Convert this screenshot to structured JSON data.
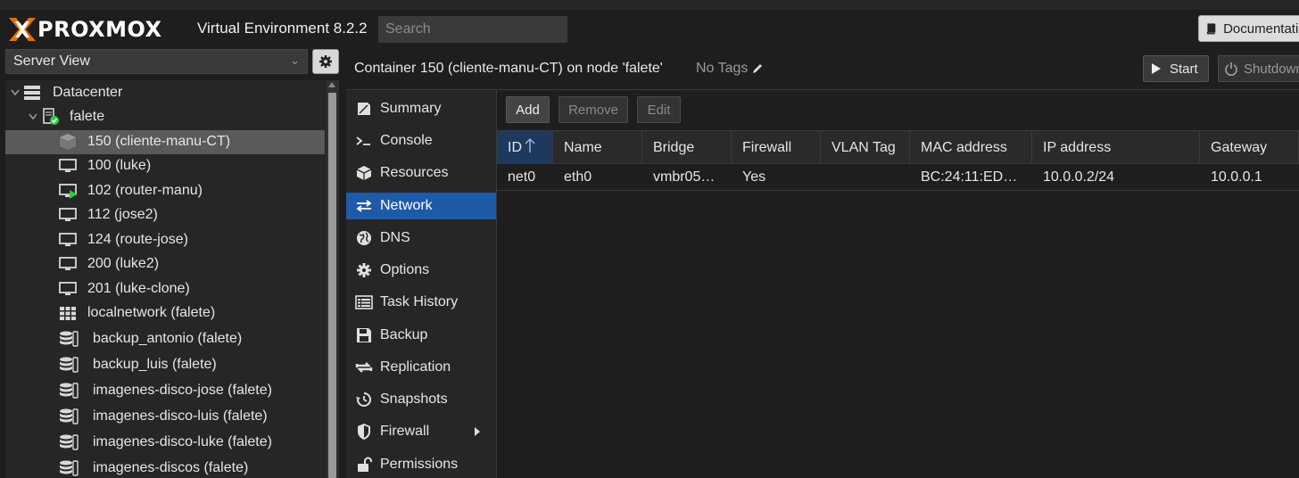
{
  "app": {
    "brand": "PROXMOX",
    "version": "Virtual Environment 8.2.2",
    "search_placeholder": "Search",
    "documentation": "Documentation"
  },
  "view_selector": {
    "value": "Server View"
  },
  "tree": [
    {
      "label": "Datacenter",
      "icon": "datacenter-icon"
    },
    {
      "label": "falete",
      "icon": "node-online-icon"
    },
    {
      "label": "150 (cliente-manu-CT)",
      "icon": "container-icon",
      "selected": true
    },
    {
      "label": "100 (luke)",
      "icon": "vm-icon"
    },
    {
      "label": "102 (router-manu)",
      "icon": "vm-running-icon"
    },
    {
      "label": "112 (jose2)",
      "icon": "vm-icon"
    },
    {
      "label": "124 (route-jose)",
      "icon": "vm-icon"
    },
    {
      "label": "200 (luke2)",
      "icon": "vm-icon"
    },
    {
      "label": "201 (luke-clone)",
      "icon": "vm-icon"
    },
    {
      "label": "localnetwork (falete)",
      "icon": "sdn-icon"
    },
    {
      "label": "backup_antonio (falete)",
      "icon": "storage-icon"
    },
    {
      "label": "backup_luis (falete)",
      "icon": "storage-icon"
    },
    {
      "label": "imagenes-disco-jose (falete)",
      "icon": "storage-icon"
    },
    {
      "label": "imagenes-disco-luis (falete)",
      "icon": "storage-icon"
    },
    {
      "label": "imagenes-disco-luke (falete)",
      "icon": "storage-icon"
    },
    {
      "label": "imagenes-discos (falete)",
      "icon": "storage-icon"
    }
  ],
  "content": {
    "title": "Container 150 (cliente-manu-CT) on node 'falete'",
    "tags": "No Tags",
    "start": "Start",
    "shutdown": "Shutdown"
  },
  "nav": [
    {
      "label": "Summary",
      "icon": "summary-icon"
    },
    {
      "label": "Console",
      "icon": "console-icon"
    },
    {
      "label": "Resources",
      "icon": "resources-icon"
    },
    {
      "label": "Network",
      "icon": "network-icon",
      "active": true
    },
    {
      "label": "DNS",
      "icon": "dns-icon"
    },
    {
      "label": "Options",
      "icon": "options-icon"
    },
    {
      "label": "Task History",
      "icon": "task-history-icon"
    },
    {
      "label": "Backup",
      "icon": "backup-icon"
    },
    {
      "label": "Replication",
      "icon": "replication-icon"
    },
    {
      "label": "Snapshots",
      "icon": "snapshots-icon"
    },
    {
      "label": "Firewall",
      "icon": "firewall-icon"
    },
    {
      "label": "Permissions",
      "icon": "permissions-icon"
    }
  ],
  "toolbar": {
    "add": "Add",
    "remove": "Remove",
    "edit": "Edit"
  },
  "grid": {
    "columns": [
      "ID",
      "Name",
      "Bridge",
      "Firewall",
      "VLAN Tag",
      "MAC address",
      "IP address",
      "Gateway"
    ],
    "rows": [
      [
        "net0",
        "eth0",
        "vmbr05…",
        "Yes",
        "",
        "BC:24:11:ED…",
        "10.0.0.2/24",
        "10.0.0.1"
      ]
    ]
  },
  "colors": {
    "accent": "#e57000",
    "selection": "#1e5aa8",
    "running": "#2ecc40"
  }
}
